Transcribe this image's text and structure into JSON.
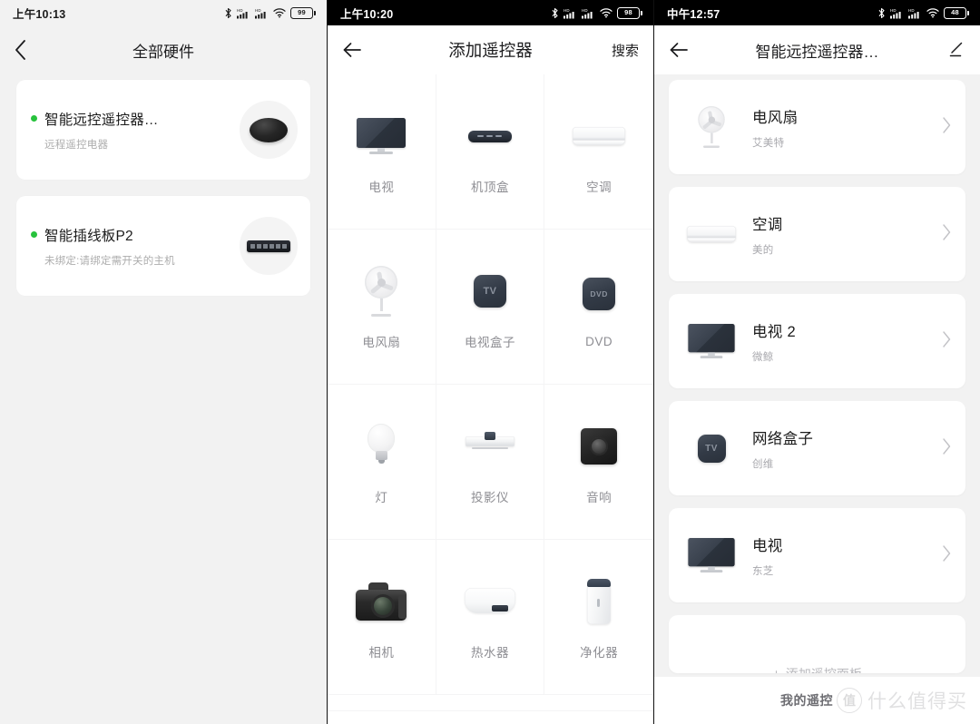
{
  "panels": {
    "all_hardware": {
      "status": {
        "time": "上午10:13",
        "battery": "99",
        "icons": [
          "bluetooth-icon",
          "signal-hd-icon",
          "signal-hd-icon",
          "wifi-icon",
          "battery-icon"
        ]
      },
      "appbar": {
        "title": "全部硬件",
        "back_icon": "chevron-left-icon"
      },
      "devices": [
        {
          "name": "智能远控遥控器…",
          "subtitle": "远程遥控电器",
          "status_color": "#27c23c",
          "thumb": "ir-puck-thumbnail"
        },
        {
          "name": "智能插线板P2",
          "subtitle": "未绑定:请绑定需开关的主机",
          "status_color": "#27c23c",
          "thumb": "power-strip-thumbnail"
        }
      ]
    },
    "add_remote": {
      "status": {
        "time": "上午10:20",
        "battery": "98",
        "icons": [
          "bluetooth-icon",
          "signal-hd-icon",
          "signal-hd-icon",
          "wifi-icon",
          "battery-icon"
        ]
      },
      "appbar": {
        "title": "添加遥控器",
        "back_icon": "arrow-left-icon",
        "action_label": "搜索"
      },
      "categories": [
        {
          "label": "电视",
          "icon": "tv-icon"
        },
        {
          "label": "机顶盒",
          "icon": "set-top-box-icon"
        },
        {
          "label": "空调",
          "icon": "air-conditioner-icon"
        },
        {
          "label": "电风扇",
          "icon": "fan-icon"
        },
        {
          "label": "电视盒子",
          "icon": "tv-box-icon",
          "badge": "TV"
        },
        {
          "label": "DVD",
          "icon": "dvd-icon",
          "badge": "DVD"
        },
        {
          "label": "灯",
          "icon": "bulb-icon"
        },
        {
          "label": "投影仪",
          "icon": "projector-icon"
        },
        {
          "label": "音响",
          "icon": "speaker-icon"
        },
        {
          "label": "相机",
          "icon": "camera-icon"
        },
        {
          "label": "热水器",
          "icon": "water-heater-icon"
        },
        {
          "label": "净化器",
          "icon": "air-purifier-icon"
        }
      ]
    },
    "my_remotes": {
      "status": {
        "time": "中午12:57",
        "battery": "48",
        "icons": [
          "bluetooth-icon",
          "signal-hd-icon",
          "signal-hd-icon",
          "wifi-icon",
          "battery-icon"
        ]
      },
      "appbar": {
        "title": "智能远控遥控器…",
        "back_icon": "arrow-left-icon",
        "action_icon": "edit-pencil-icon"
      },
      "remotes": [
        {
          "name": "电风扇",
          "brand": "艾美特",
          "icon": "fan-icon",
          "chevron": "chevron-right-icon"
        },
        {
          "name": "空调",
          "brand": "美的",
          "icon": "air-conditioner-icon",
          "chevron": "chevron-right-icon"
        },
        {
          "name": "电视 2",
          "brand": "微鲸",
          "icon": "tv-icon",
          "chevron": "chevron-right-icon"
        },
        {
          "name": "网络盒子",
          "brand": "创维",
          "icon": "tv-box-icon",
          "badge": "TV",
          "chevron": "chevron-right-icon"
        },
        {
          "name": "电视",
          "brand": "东芝",
          "icon": "tv-icon",
          "chevron": "chevron-right-icon"
        }
      ],
      "add_card": {
        "label": "添加遥控面板",
        "icon": "plus-icon"
      },
      "footer": {
        "label": "我的遥控",
        "watermark_badge": "值",
        "watermark_text": "什么值得买"
      }
    }
  }
}
